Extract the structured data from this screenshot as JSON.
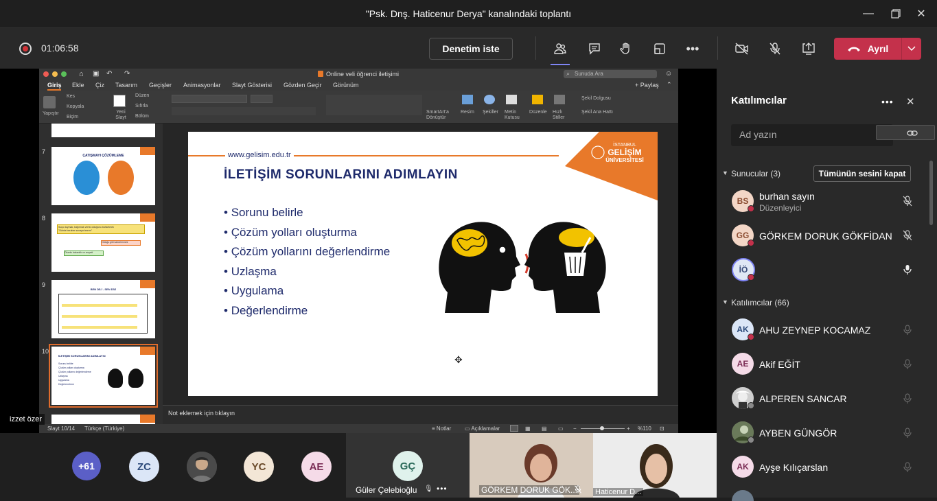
{
  "window": {
    "title": "\"Psk. Dnş. Haticenur Derya\" kanalındaki toplantı"
  },
  "toolbar": {
    "timer": "01:06:58",
    "ask_label": "Denetim iste",
    "leave_label": "Ayrıl"
  },
  "ppt": {
    "doc_title": "Online veli öğrenci iletişimi",
    "search_placeholder": "Sunuda Ara",
    "tabs": [
      "Giriş",
      "Ekle",
      "Çiz",
      "Tasarım",
      "Geçişler",
      "Animasyonlar",
      "Slayt Gösterisi",
      "Gözden Geçir",
      "Görünüm"
    ],
    "share_label": "Paylaş",
    "ribbon": {
      "paste": "Yapıştır",
      "cut": "Kes",
      "copy": "Kopyala",
      "format": "Biçim",
      "new_slide": "Yeni Slayt",
      "layout": "Düzen",
      "reset": "Sıfırla",
      "section": "Bölüm",
      "smartart": "SmartArt'a Dönüştür",
      "picture": "Resim",
      "shapes": "Şekiller",
      "textbox": "Metin Kutusu",
      "arrange": "Düzenle",
      "quick_styles": "Hızlı Stiller",
      "shape_fill": "Şekil Dolgusu",
      "shape_outline": "Şekil Ana Hattı"
    },
    "thumbnails": [
      {
        "num": "7",
        "title": "ÇATIŞMAYI ÇÖZÜMLEME"
      },
      {
        "num": "8",
        "title": ""
      },
      {
        "num": "9",
        "title": "BEN DİLİ - SEN DİLİ"
      },
      {
        "num": "10",
        "title": "İLETİŞİM SORUNLARINI ADIMLAYIN"
      }
    ],
    "thumb8_lines": [
      "Suçu duymak, bağırmak verbü olduğunu bahsetmek",
      "\"Sizinle beraber sunaya tanrım\"",
      "Olduğu gibi kabullenmek",
      "Olumlu bakanlık ve empati"
    ],
    "thumb10_items": [
      "Sorunu belirle",
      "Çözüm yolları oluşturma",
      "Çözüm yollarını değerlendirme",
      "Uzlaşma",
      "Uygulama",
      "Değerlendirme"
    ],
    "slide": {
      "url": "www.gelisim.edu.tr",
      "logo_line1": "İSTANBUL",
      "logo_line2": "GELİŞİM",
      "logo_line3": "ÜNİVERSİTESİ",
      "title": "İLETİŞİM SORUNLARINI ADIMLAYIN",
      "bullets": [
        "Sorunu belirle",
        "Çözüm yolları oluşturma",
        "Çözüm yollarını değerlendirme",
        "Uzlaşma",
        "Uygulama",
        "Değerlendirme"
      ]
    },
    "notes_placeholder": "Not eklemek için tıklayın",
    "status": {
      "slide_info": "Slayt 10/14",
      "language": "Türkçe (Türkiye)",
      "notes": "Notlar",
      "comments": "Açıklamalar",
      "zoom": "%110"
    }
  },
  "presenter_label": "izzet özer",
  "participants_panel": {
    "title": "Katılımcılar",
    "search_placeholder": "Ad yazın",
    "presenters_header": "Sunucular (3)",
    "mute_all": "Tümünün sesini kapat",
    "attendees_header": "Katılımcılar (66)",
    "presenters": [
      {
        "initials": "BS",
        "name": "burhan sayın",
        "role": "Düzenleyici",
        "bg": "#f3d6c6",
        "fg": "#8a4b2f"
      },
      {
        "initials": "GG",
        "name": "GÖRKEM DORUK GÖKFİDAN",
        "role": "",
        "bg": "#f3d6c6",
        "fg": "#8a4b2f"
      },
      {
        "initials": "İÖ",
        "name": "",
        "role": "",
        "bg": "#dfe7f5",
        "fg": "#3a4d7a"
      }
    ],
    "attendees": [
      {
        "initials": "AK",
        "name": "AHU ZEYNEP KOCAMAZ",
        "bg": "#dbe6f7",
        "fg": "#2c4a7a"
      },
      {
        "initials": "AE",
        "name": "Akif EĞİT",
        "bg": "#f5dbe8",
        "fg": "#7a2c55"
      },
      {
        "initials": "",
        "name": "ALPEREN SANCAR",
        "bg": "#cfcfcf",
        "fg": "#333"
      },
      {
        "initials": "",
        "name": "AYBEN GÜNGÖR",
        "bg": "#7a8a6a",
        "fg": "#fff"
      },
      {
        "initials": "AK",
        "name": "Ayşe Kılıçarslan",
        "bg": "#f5dbe8",
        "fg": "#7a2c55"
      }
    ]
  },
  "bottom_strip": {
    "more_count": "+61",
    "avatars": [
      {
        "initials": "ZC",
        "bg": "#dbe6f7",
        "fg": "#2c4a7a"
      },
      {
        "initials": "",
        "bg": "#5a5a5a",
        "fg": "#fff"
      },
      {
        "initials": "YC",
        "bg": "#f3e6d6",
        "fg": "#6a4a2a"
      },
      {
        "initials": "AE",
        "bg": "#f5dbe8",
        "fg": "#7a2c55"
      }
    ],
    "tile1": {
      "initials": "GÇ",
      "name": "Güler Çelebioğlu"
    },
    "tile2": {
      "name": "GÖRKEM DORUK GÖK..."
    },
    "tile3": {
      "name": "Haticenur D..."
    }
  },
  "colors": {
    "accent_red": "#c4314b",
    "brand_orange": "#e8792a",
    "slide_title_navy": "#1e2a6b"
  }
}
